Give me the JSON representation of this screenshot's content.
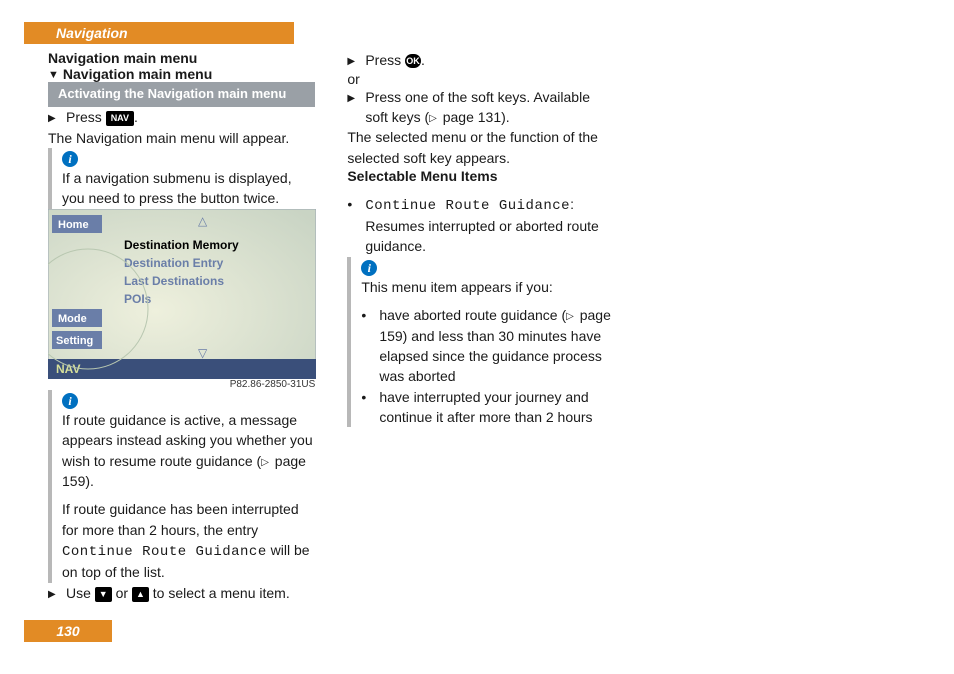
{
  "header": {
    "tab": "Navigation",
    "page_number": "130"
  },
  "col1": {
    "h1": "Navigation main menu",
    "h2": "Navigation main menu",
    "greybox": "Activating the Navigation main menu",
    "step1_a": "Press ",
    "btn_nav": "NAV",
    "step1_b": ".",
    "step1_result": "The Navigation main menu will appear.",
    "note1": "If a navigation submenu is displayed, you need to press the button twice.",
    "screenshot": {
      "home": "Home",
      "mode": "Mode",
      "setting": "Setting",
      "nav": "NAV",
      "item_sel": "Destination Memory",
      "item2": "Destination Entry",
      "item3": "Last Destinations",
      "item4": "POIs",
      "caption": "P82.86-2850-31US"
    }
  },
  "col2": {
    "note2a": "If route guidance is active, a message appears instead asking you whether you wish to resume route guidance (",
    "note2a_ref": " page 159).",
    "note2b_a": "If route guidance has been interrupted for more than 2 hours, the entry ",
    "note2b_code": "Continue Route Guidance",
    "note2b_b": " will be on top of the list.",
    "step2_a": "Use ",
    "step2_b": " or ",
    "step2_c": " to select a menu item.",
    "step3_a": "Press ",
    "btn_ok": "OK",
    "step3_b": ".",
    "or": "or",
    "step4_a": "Press one of the soft keys. Available soft keys (",
    "step4_ref": " page 131).",
    "step4_result": "The selected menu or the function of the selected soft key appears."
  },
  "col3": {
    "heading": "Selectable Menu Items",
    "b1_code": "Continue Route Guidance",
    "b1_rest": ": Resumes interrupted or aborted route guidance.",
    "note3_intro": "This menu item appears if you:",
    "note3_b1_a": "have aborted route guidance (",
    "note3_b1_ref": " page 159) and less than 30 minutes have elapsed since the guidance process was aborted",
    "note3_b2": "have interrupted your journey and continue it after more than 2 hours"
  }
}
